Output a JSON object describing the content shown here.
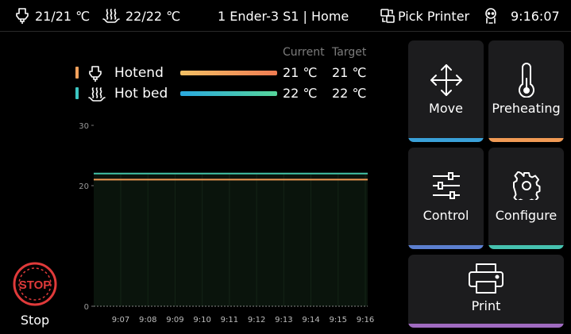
{
  "status": {
    "hotend_temp": "21/21 ℃",
    "bed_temp": "22/22 ℃",
    "title": "1 Ender-3 S1 | Home",
    "pick_printer": "Pick Printer",
    "time": "9:16:07"
  },
  "legend": {
    "current_header": "Current",
    "target_header": "Target",
    "rows": [
      {
        "name": "Hotend",
        "current": "21 ℃",
        "target": "21 ℃",
        "color": "#f2a15c"
      },
      {
        "name": "Hot bed",
        "current": "22 ℃",
        "target": "22 ℃",
        "color": "#3cc6c2"
      }
    ]
  },
  "chart_data": {
    "type": "line",
    "x": [
      "9:07",
      "9:08",
      "9:09",
      "9:10",
      "9:11",
      "9:12",
      "9:13",
      "9:14",
      "9:15",
      "9:16"
    ],
    "ylim": [
      0,
      30
    ],
    "yticks": [
      0,
      20,
      30
    ],
    "series": [
      {
        "name": "Hotend",
        "values": [
          21,
          21,
          21,
          21,
          21,
          21,
          21,
          21,
          21,
          21
        ],
        "color": "#f09a55"
      },
      {
        "name": "Hot bed",
        "values": [
          22,
          22,
          22,
          22,
          22,
          22,
          22,
          22,
          22,
          22
        ],
        "color": "#42c3a8"
      }
    ],
    "grid": true
  },
  "actions": {
    "stop_label": "Stop",
    "stop_badge": "STOP",
    "move": "Move",
    "preheating": "Preheating",
    "control": "Control",
    "configure": "Configure",
    "print": "Print"
  },
  "colors": {
    "move_bar": "#3aa0d8",
    "preheat_bar": "#f09a55",
    "control_bar": "#5c7fd0",
    "configure_bar": "#46c2b0",
    "print_bar": "#a06bc0",
    "stop_red": "#e03a3a"
  }
}
